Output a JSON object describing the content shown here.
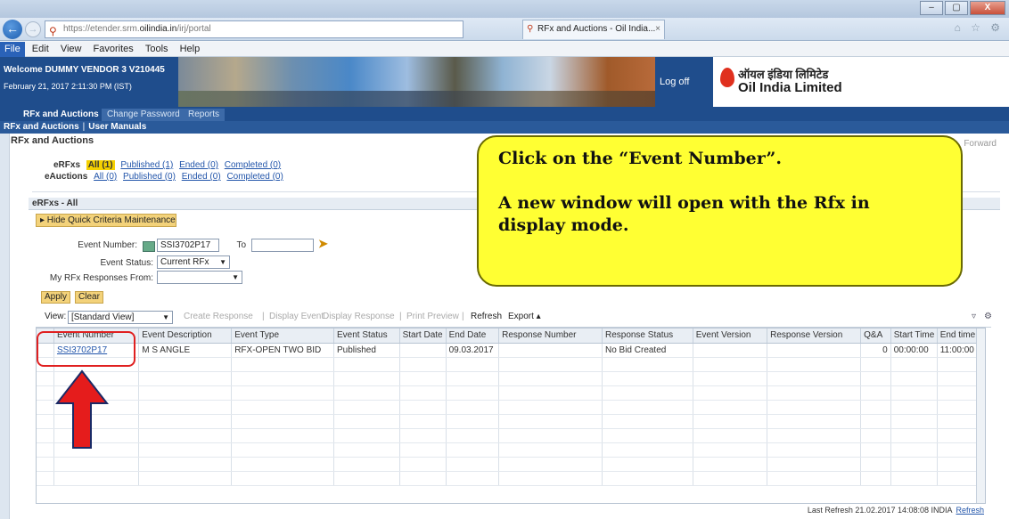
{
  "browser": {
    "address": "https://etender.srm.oilindia.in/irj/portal",
    "address_prefix": "https://etender.srm.",
    "address_host": "oilindia.in",
    "address_rest": "/irj/portal",
    "tab_title": "RFx and Auctions - Oil India...",
    "window_buttons": [
      "–",
      "▢",
      "X"
    ],
    "search_tools": "⌕ ▾ 🔒 ↻",
    "right_icons": "⌂ ☆ ⚙"
  },
  "menu": {
    "items": [
      "File",
      "Edit",
      "View",
      "Favorites",
      "Tools",
      "Help"
    ]
  },
  "portal": {
    "welcome": "Welcome DUMMY VENDOR 3 V210445",
    "date": "February 21, 2017 2:11:30 PM (IST)",
    "logoff": "Log off",
    "logo_hindi": "ऑयल इंडिया लिमिटेड",
    "logo_english": "Oil India Limited",
    "tabs": [
      "RFx and Auctions",
      "Change Password",
      "Reports"
    ],
    "subnav": [
      "RFx and Auctions",
      "User Manuals"
    ],
    "subnav_sep": "|"
  },
  "content": {
    "title": "RFx and Auctions",
    "forward": "Forward",
    "erfx_row": {
      "label": "eRFxs",
      "links": [
        "All (1)",
        "Published (1)",
        "Ended (0)",
        "Completed (0)"
      ]
    },
    "eauction_row": {
      "label": "eAuctions",
      "links": [
        "All (0)",
        "Published (0)",
        "Ended (0)",
        "Completed (0)"
      ]
    },
    "section_title": "eRFxs - All",
    "quick_criteria": "▸ Hide Quick Criteria Maintenance",
    "form": {
      "event_number_label": "Event Number:",
      "event_number_value": "SSI3702P17",
      "to_label": "To",
      "event_status_label": "Event Status:",
      "event_status_value": "Current RFx",
      "my_responses_label": "My RFx Responses From:",
      "apply": "Apply",
      "clear": "Clear"
    },
    "toolbar": {
      "view_label": "View:",
      "view_value": "[Standard View]",
      "create_response": "Create Response",
      "display_event": "Display Event",
      "display_response": "Display Response",
      "print_preview": "Print Preview",
      "refresh": "Refresh",
      "export": "Export ▴",
      "sep": "|"
    },
    "grid": {
      "columns": [
        "",
        "Event Number",
        "Event Description",
        "Event Type",
        "Event Status",
        "Start Date",
        "End Date",
        "Response Number",
        "Response Status",
        "Event Version",
        "Response Version",
        "Q&A",
        "Start Time",
        "End time"
      ],
      "rows": [
        [
          "",
          "SSI3702P17",
          "M S ANGLE",
          "RFX-OPEN TWO BID",
          "Published",
          "",
          "09.03.2017",
          "",
          "No Bid Created",
          "",
          "",
          "0",
          "00:00:00",
          "11:00:00"
        ]
      ]
    },
    "last_refresh": "Last Refresh 21.02.2017 14:08:08 INDIA",
    "refresh_link": "Refresh"
  },
  "callout": {
    "line1": "Click on the “Event Number”.",
    "line2": "A new window will open with the Rfx in display mode."
  },
  "colors": {
    "header_blue": "#1f4d8c",
    "callout_yellow": "#ffff33",
    "highlight_red": "#e02020"
  }
}
